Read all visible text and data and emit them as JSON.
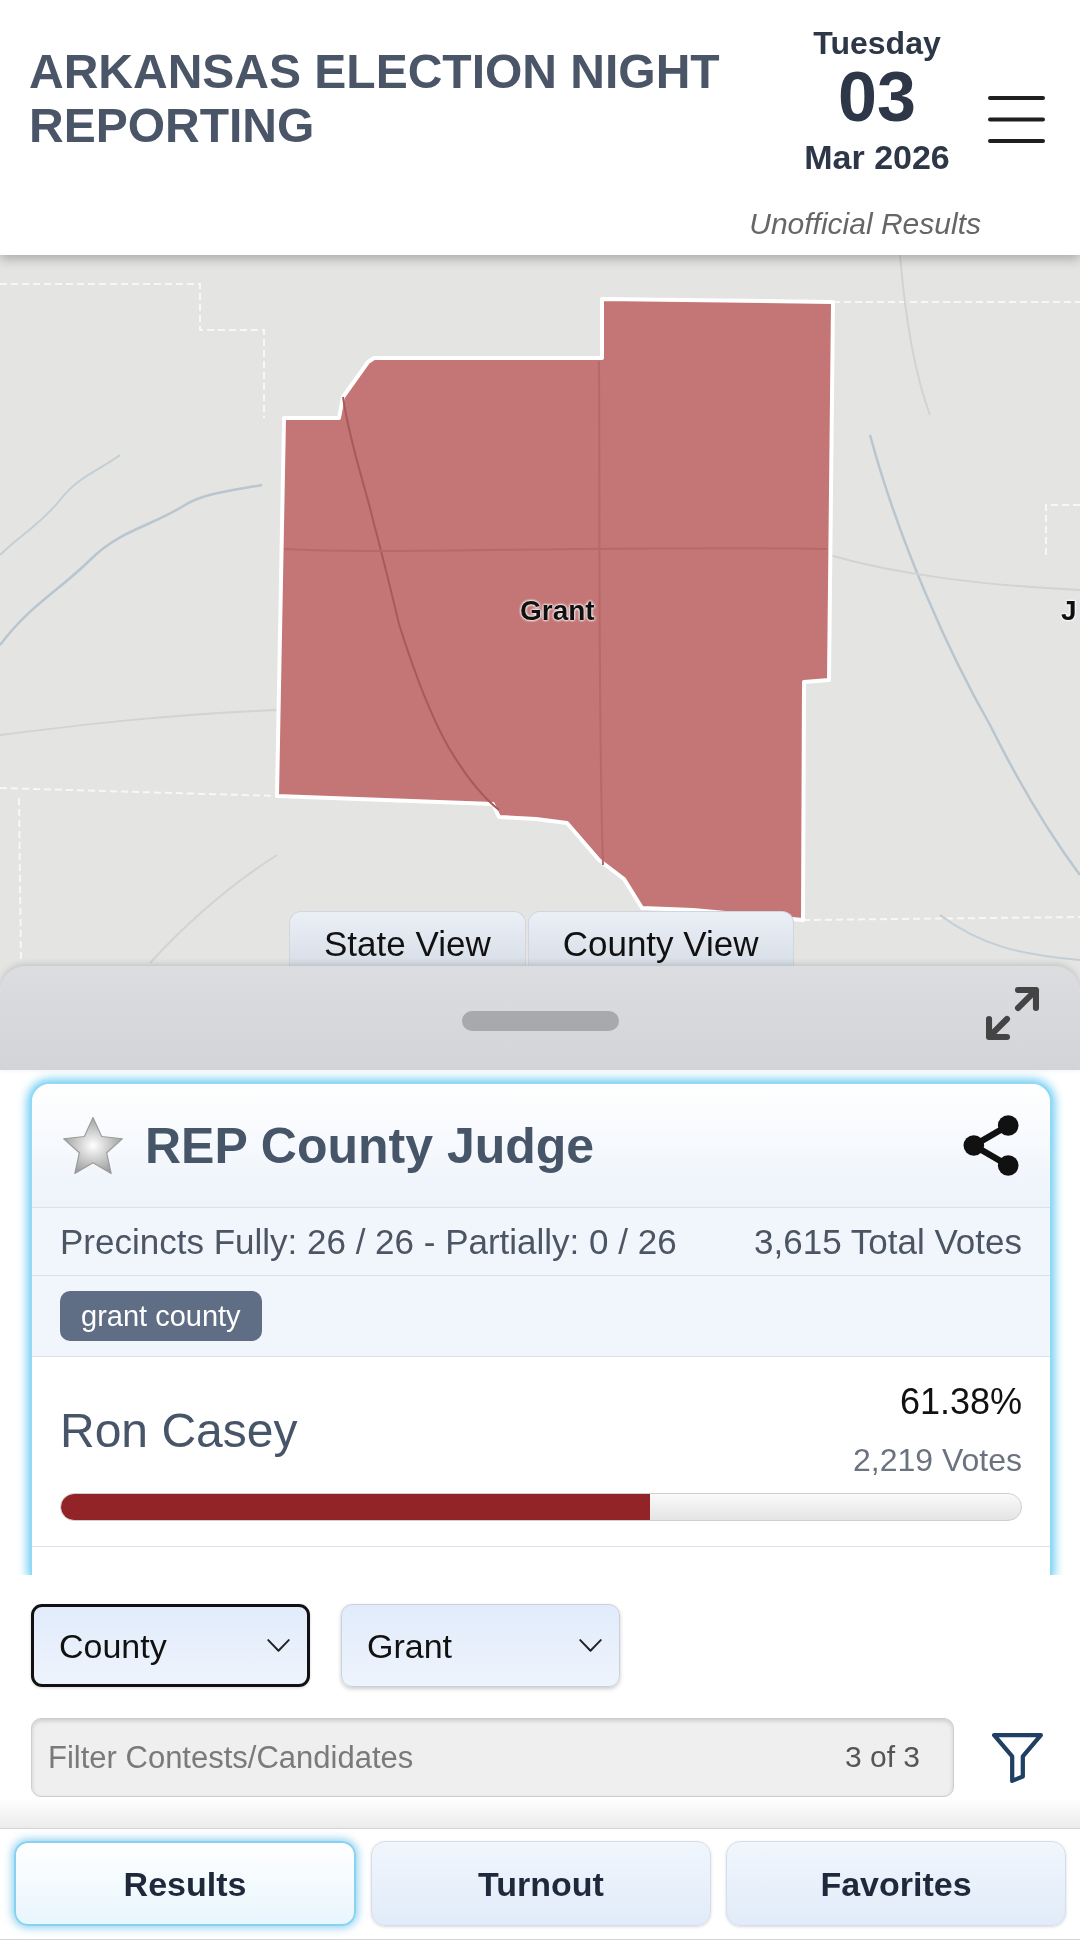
{
  "header": {
    "title": "ARKANSAS ELECTION NIGHT REPORTING",
    "date": {
      "weekday": "Tuesday",
      "day": "03",
      "month_year": "Mar 2026"
    },
    "status": "Unofficial Results"
  },
  "map": {
    "labels": [
      "Grant",
      "J"
    ],
    "view_buttons": [
      "State View",
      "County View"
    ]
  },
  "contest": {
    "favorite": false,
    "title": "REP County Judge",
    "precincts": "Precincts Fully: 26 / 26 - Partially: 0 / 26",
    "total_votes": "3,615 Total Votes",
    "tags": [
      "grant county"
    ],
    "candidates": [
      {
        "name": "Ron Casey",
        "percent": "61.38%",
        "votes": "2,219 Votes",
        "level": 0.6138
      }
    ]
  },
  "filters": {
    "selects": [
      {
        "value": "County",
        "focused": true
      },
      {
        "value": "Grant",
        "focused": false
      }
    ],
    "search": {
      "placeholder": "Filter Contests/Candidates",
      "count": "3 of 3"
    }
  },
  "tabs": [
    {
      "label": "Results",
      "selected": true
    },
    {
      "label": "Turnout",
      "selected": false
    },
    {
      "label": "Favorites",
      "selected": false
    }
  ]
}
